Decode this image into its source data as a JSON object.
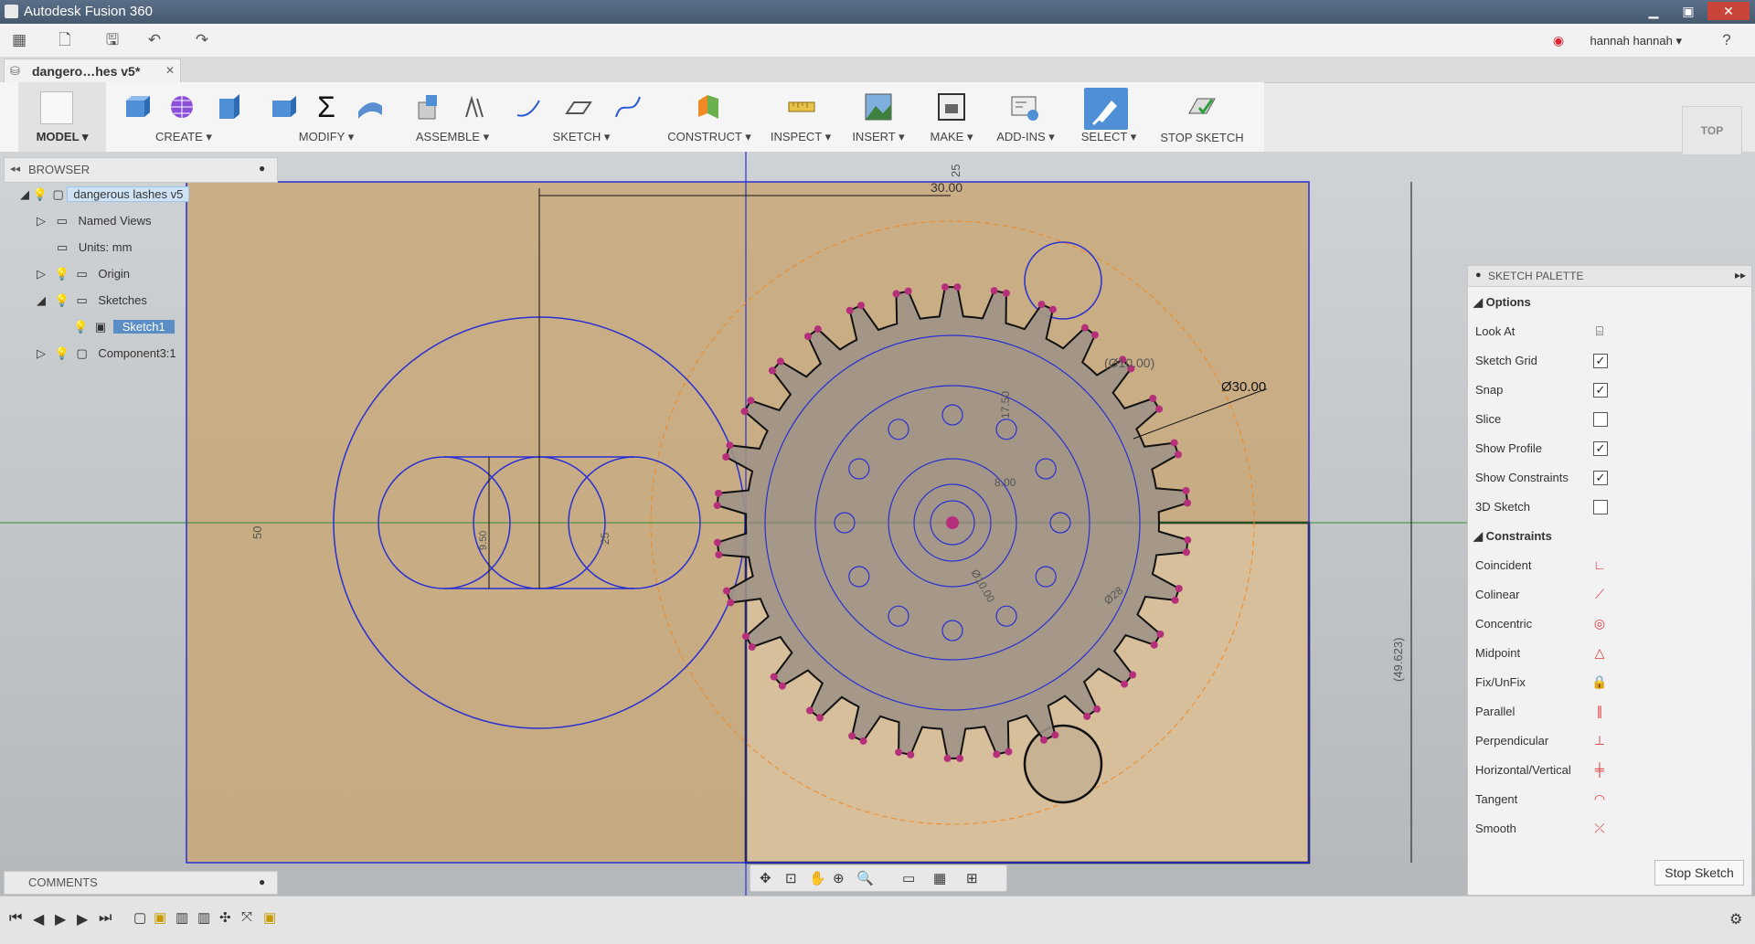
{
  "app": {
    "title": "Autodesk Fusion 360"
  },
  "quickbar": {
    "user": "hannah hannah"
  },
  "tab": {
    "label": "dangero…hes v5*",
    "close": "✕"
  },
  "toolbar": {
    "workspace": "MODEL",
    "groups": [
      "CREATE",
      "MODIFY",
      "ASSEMBLE",
      "SKETCH",
      "CONSTRUCT",
      "INSPECT",
      "INSERT",
      "MAKE",
      "ADD-INS",
      "SELECT"
    ],
    "stop_sketch": "STOP SKETCH",
    "dropdown_marker": "▾"
  },
  "browser": {
    "header": "BROWSER",
    "root": "dangerous lashes v5",
    "items": [
      "Named Views",
      "Units: mm",
      "Origin",
      "Sketches",
      "Sketch1",
      "Component3:1"
    ]
  },
  "viewcube": {
    "label": "TOP"
  },
  "dimensions": {
    "d1": "30.00",
    "d2": "Ø30.00",
    "d3": "(Ø10.00)",
    "d4": "25",
    "d5": "50",
    "d6": "(49.623)",
    "d7": "17.50",
    "d8": "8.00",
    "d9": "9.50",
    "d10": "Ø28",
    "d11": "25",
    "d12": "Ø10.00"
  },
  "palette": {
    "header": "SKETCH PALETTE",
    "options_title": "Options",
    "options": [
      {
        "label": "Look At",
        "checked": null
      },
      {
        "label": "Sketch Grid",
        "checked": true
      },
      {
        "label": "Snap",
        "checked": true
      },
      {
        "label": "Slice",
        "checked": false
      },
      {
        "label": "Show Profile",
        "checked": true
      },
      {
        "label": "Show Constraints",
        "checked": true
      },
      {
        "label": "3D Sketch",
        "checked": false
      }
    ],
    "constraints_title": "Constraints",
    "constraints": [
      "Coincident",
      "Colinear",
      "Concentric",
      "Midpoint",
      "Fix/UnFix",
      "Parallel",
      "Perpendicular",
      "Horizontal/Vertical",
      "Tangent",
      "Smooth"
    ],
    "stop_button": "Stop Sketch",
    "accent": "#e03a3a"
  },
  "comments": {
    "header": "COMMENTS"
  },
  "colors": {
    "sketch_blue": "#2a2fd1",
    "profile_fill": "#c9a878",
    "gear_fill": "#a09386",
    "point": "#b52f7a",
    "construction": "#f08a24"
  }
}
